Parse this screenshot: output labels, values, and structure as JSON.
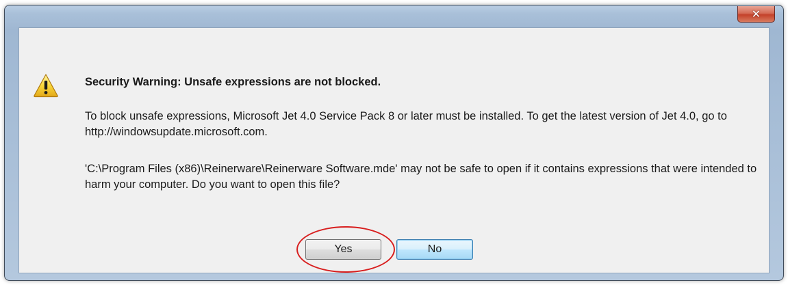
{
  "dialog": {
    "close_icon": "close-icon",
    "close_glyph": "✕",
    "warning_icon": "warning-triangle-icon",
    "title": "Security Warning: Unsafe expressions are not blocked.",
    "paragraph1": "To block unsafe expressions, Microsoft Jet 4.0 Service Pack 8 or later must be installed. To get the latest version of Jet 4.0, go to http://windowsupdate.microsoft.com.",
    "paragraph2": "'C:\\Program Files (x86)\\Reinerware\\Reinerware Software.mde' may not be safe to open if it contains expressions that were intended to harm your computer. Do you want to open this file?",
    "yes_label": "Yes",
    "no_label": "No"
  },
  "colors": {
    "frame": "#a9c0d9",
    "client_background": "#f0f0f0",
    "close_button": "#c4412a",
    "default_button": "#bee6fd",
    "annotation_ring": "#d81f1f"
  }
}
